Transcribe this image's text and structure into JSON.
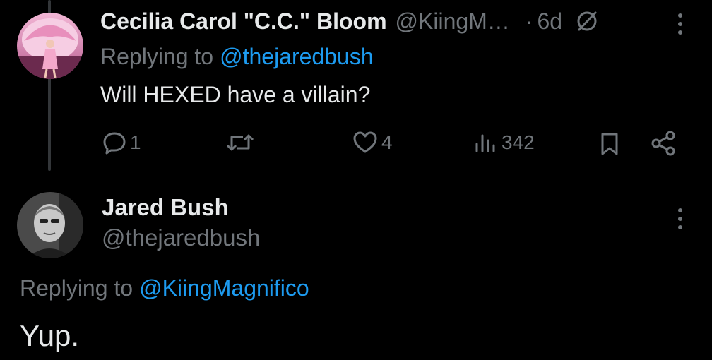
{
  "tweet1": {
    "author_name": "Cecilia Carol \"C.C.\" Bloom",
    "handle": "@KiingM…",
    "separator": "·",
    "time": "6d",
    "replying_label": "Replying to",
    "replying_to": "@thejaredbush",
    "text": "Will HEXED have a villain?",
    "actions": {
      "replies": "1",
      "reposts": "",
      "likes": "4",
      "views": "342"
    }
  },
  "tweet2": {
    "author_name": "Jared Bush",
    "handle": "@thejaredbush",
    "replying_label": "Replying to",
    "replying_to": "@KiingMagnifico",
    "text": "Yup."
  },
  "colors": {
    "background": "#000000",
    "text": "#e7e9ea",
    "muted": "#71767b",
    "link": "#1d9bf0"
  },
  "icons": [
    "reply-icon",
    "repost-icon",
    "like-icon",
    "views-icon",
    "bookmark-icon",
    "share-icon",
    "more-icon",
    "community-note-icon"
  ]
}
